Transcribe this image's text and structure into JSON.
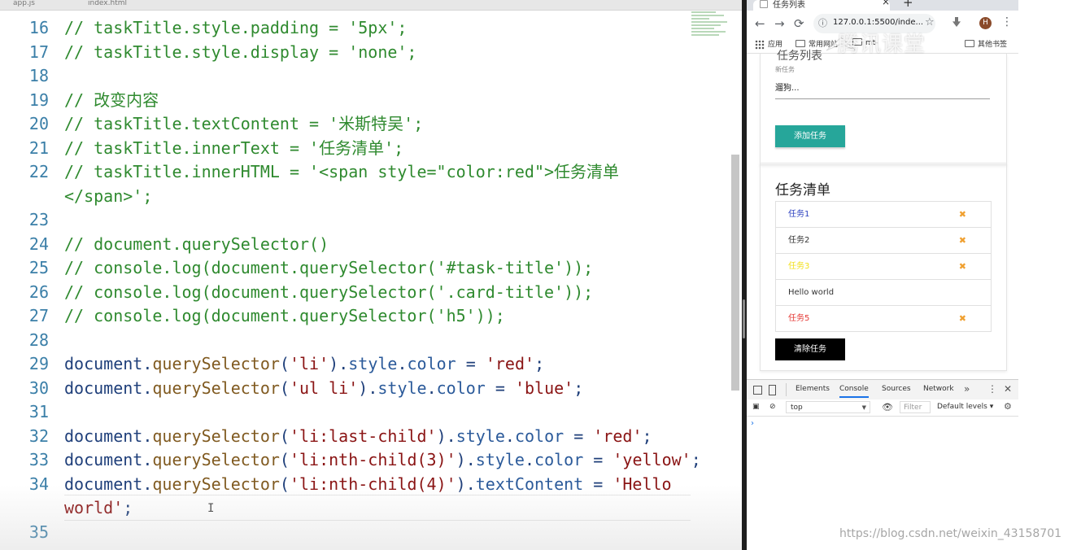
{
  "editor": {
    "tabs": [
      "app.js",
      "index.html"
    ],
    "lines": [
      {
        "num": "16",
        "text": "// taskTitle.style.padding = '5px';"
      },
      {
        "num": "17",
        "text": "// taskTitle.style.display = 'none';"
      },
      {
        "num": "18",
        "text": ""
      },
      {
        "num": "19",
        "text": "// 改变内容"
      },
      {
        "num": "20",
        "text": "// taskTitle.textContent = '米斯特吴';"
      },
      {
        "num": "21",
        "text": "// taskTitle.innerText = '任务清单';"
      },
      {
        "num": "22",
        "text": "// taskTitle.innerHTML = '<span style=\"color:red\">任务清单"
      },
      {
        "num": "",
        "text": "</span>';"
      },
      {
        "num": "23",
        "text": ""
      },
      {
        "num": "24",
        "text": "// document.querySelector()"
      },
      {
        "num": "25",
        "text": "// console.log(document.querySelector('#task-title'));"
      },
      {
        "num": "26",
        "text": "// console.log(document.querySelector('.card-title'));"
      },
      {
        "num": "27",
        "text": "// console.log(document.querySelector('h5'));"
      },
      {
        "num": "28",
        "text": ""
      },
      {
        "num": "29",
        "text": "document.querySelector('li').style.color = 'red';"
      },
      {
        "num": "30",
        "text": "document.querySelector('ul li').style.color = 'blue';"
      },
      {
        "num": "31",
        "text": ""
      },
      {
        "num": "32",
        "text": "document.querySelector('li:last-child').style.color = 'red';"
      },
      {
        "num": "33",
        "text": "document.querySelector('li:nth-child(3)').style.color = 'yellow';"
      },
      {
        "num": "34",
        "text": "document.querySelector('li:nth-child(4)').textContent = 'Hello"
      },
      {
        "num": "",
        "text": "world';"
      },
      {
        "num": "35",
        "text": ""
      }
    ],
    "colors": {
      "comment": "#2f8a2f",
      "string": "#8a1414",
      "identifier": "#1f3f7a",
      "method": "#805a20",
      "line_number": "#3b7fa8"
    }
  },
  "browser": {
    "tab_title": "任务列表",
    "url": "127.0.0.1:5500/inde...",
    "avatar_letter": "H",
    "bookmarks": {
      "apps": "应用",
      "common": "常用网站",
      "mt": "mt-",
      "other": "其他书签"
    },
    "watermark": "腾讯课堂",
    "page": {
      "partial_title": "任务列表",
      "new_task_label": "新任务",
      "new_task_value": "遛狗...",
      "add_button": "添加任务",
      "list_title": "任务清单",
      "tasks": [
        {
          "label": "任务1",
          "color": "#2a3fbf",
          "has_delete": true
        },
        {
          "label": "任务2",
          "color": "#333333",
          "has_delete": true
        },
        {
          "label": "任务3",
          "color": "#f2e01b",
          "has_delete": true
        },
        {
          "label": "Hello world",
          "color": "#333333",
          "has_delete": false
        },
        {
          "label": "任务5",
          "color": "#e53935",
          "has_delete": true
        }
      ],
      "delete_icon": "✖",
      "clear_button": "清除任务",
      "accent_color": "#26a69a"
    },
    "devtools": {
      "tabs": [
        "Elements",
        "Console",
        "Sources",
        "Network"
      ],
      "active_tab": "Console",
      "more": "»",
      "context": "top",
      "filter_placeholder": "Filter",
      "levels": "Default levels ▾",
      "prompt": "›"
    }
  },
  "footer_watermark": "https://blog.csdn.net/weixin_43158701"
}
